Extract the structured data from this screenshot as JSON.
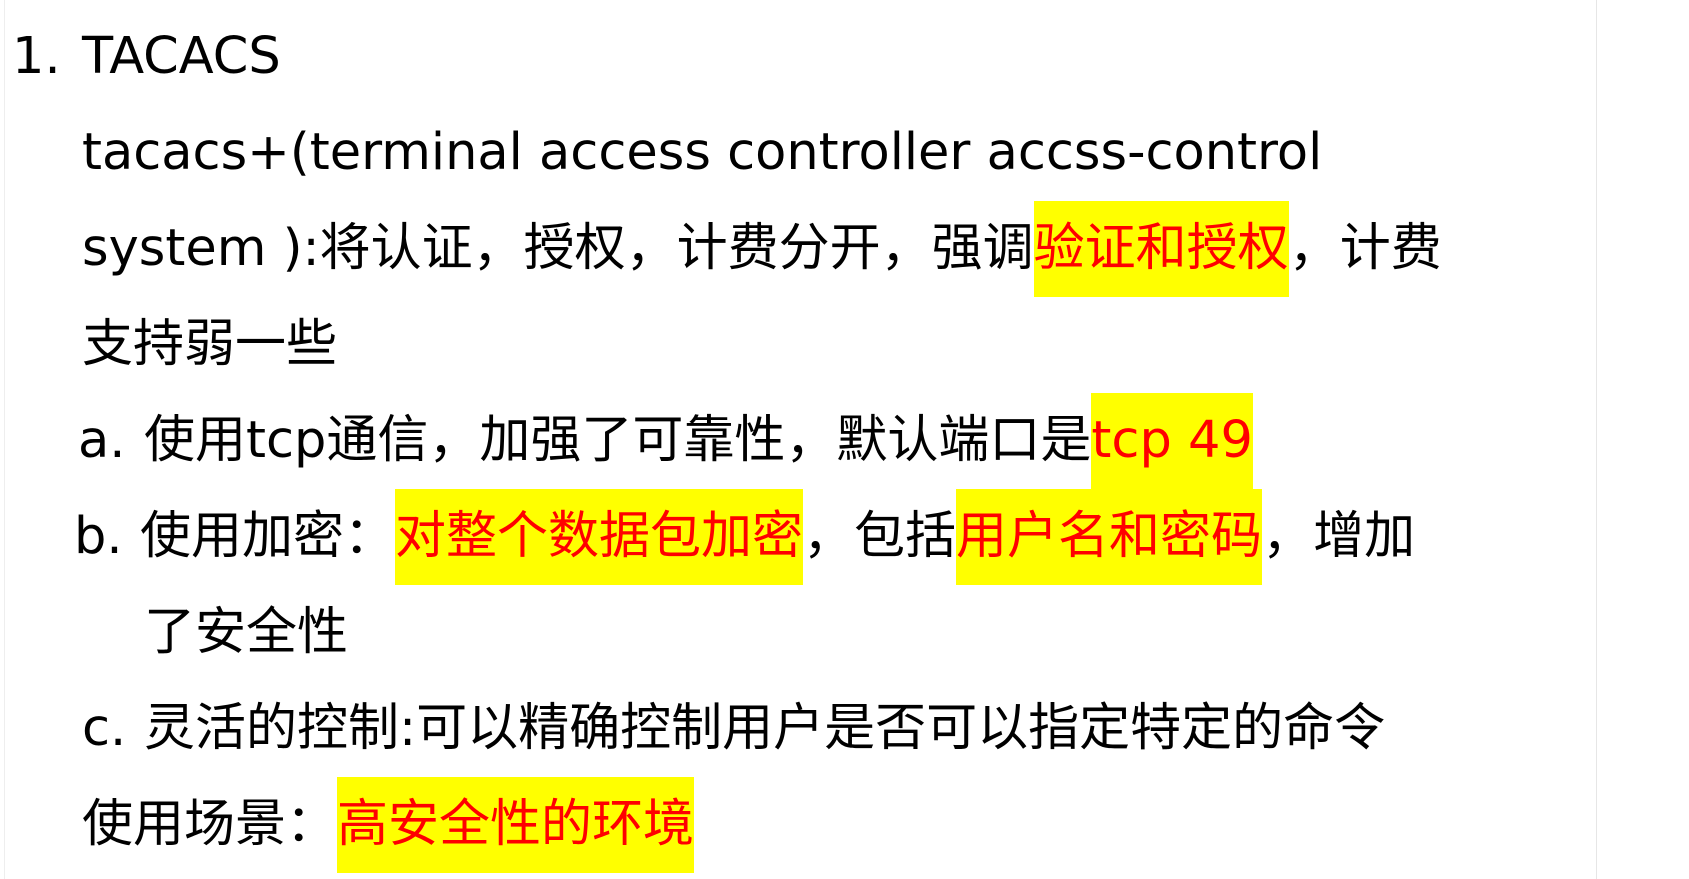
{
  "heading": {
    "number": "1.",
    "title": "TACACS"
  },
  "intro": {
    "line1": "tacacs+(terminal access controller accss-control",
    "line2_pre": "system ):将认证，授权，计费分开，强调",
    "line2_highlight": "验证和授权",
    "line2_post": "，计费",
    "line3": "支持弱一些"
  },
  "items": {
    "a": {
      "marker": "a.",
      "pre": "使用tcp通信，加强了可靠性，默认端口是",
      "highlight": "tcp 49"
    },
    "b": {
      "marker": "b.",
      "pre": "使用加密：",
      "highlight1": "对整个数据包加密",
      "mid": "，包括",
      "highlight2": "用户名和密码",
      "post": "，增加",
      "continuation": "了安全性"
    },
    "c": {
      "marker": "c.",
      "text": "灵活的控制:可以精确控制用户是否可以指定特定的命令"
    }
  },
  "usage": {
    "label": "使用场景：",
    "highlight": "高安全性的环境"
  },
  "colors": {
    "highlight_background": "#ffff00",
    "highlight_text": "#ff0000",
    "body_text": "#000000"
  }
}
